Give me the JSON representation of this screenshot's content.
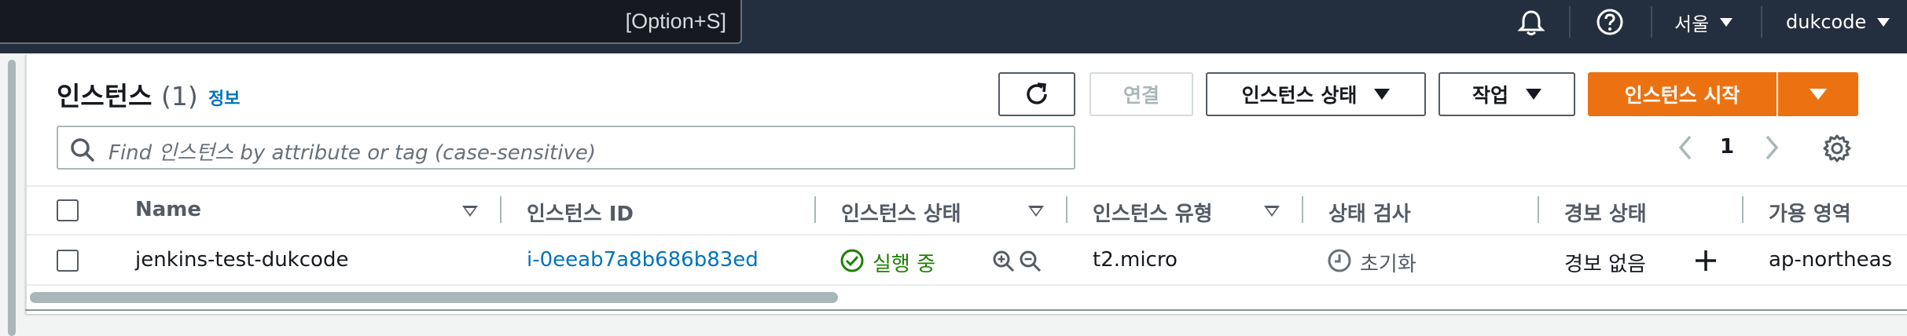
{
  "topbar": {
    "search_shortcut": "[Option+S]",
    "region": "서울",
    "account": "dukcode"
  },
  "header": {
    "title": "인스턴스",
    "count": "(1)",
    "info_link": "정보"
  },
  "toolbar": {
    "connect_label": "연결",
    "instance_state_label": "인스턴스 상태",
    "actions_label": "작업",
    "launch_label": "인스턴스 시작"
  },
  "filter": {
    "placeholder": "Find 인스턴스 by attribute or tag (case-sensitive)"
  },
  "pagination": {
    "current_page": "1"
  },
  "table": {
    "columns": [
      "Name",
      "인스턴스 ID",
      "인스턴스 상태",
      "인스턴스 유형",
      "상태 검사",
      "경보 상태",
      "가용 영역"
    ],
    "rows": [
      {
        "name": "jenkins-test-dukcode",
        "instance_id": "i-0eeab7a8b686b83ed",
        "state": "실행 중",
        "type": "t2.micro",
        "status_check": "초기화",
        "alarm_status": "경보 없음",
        "az": "ap-northeas"
      }
    ]
  },
  "colors": {
    "topbar_bg": "#232f3e",
    "primary": "#ec7211",
    "link": "#0073bb",
    "running": "#1d8102"
  }
}
